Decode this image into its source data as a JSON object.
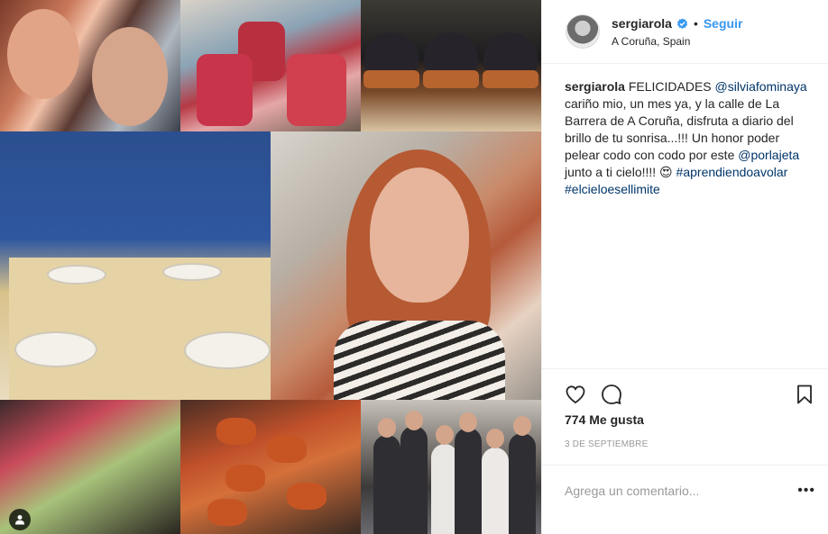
{
  "post": {
    "username": "sergiarola",
    "follow_label": "Seguir",
    "separator": "•",
    "location": "A Coruña, Spain",
    "caption": {
      "username": "sergiarola",
      "text_1": " FELICIDADES ",
      "mention_1": "@silviafominaya",
      "text_2": " cariño mio, un mes ya, y la calle de La Barrera de A Coruña, disfruta a diario del brillo de tu sonrisa...!!! Un honor poder pelear codo con codo por este ",
      "mention_2": "@porlajeta",
      "text_3": " junto a ti cielo!!!! 😍 ",
      "hashtag_1": "#aprendiendoavolar",
      "hashtag_2": "#elcieloesellimite"
    },
    "likes": "774 Me gusta",
    "date": "3 DE SEPTIEMBRE",
    "comment_placeholder": "Agrega un comentario...",
    "more_label": "•••"
  },
  "icons": {
    "verified": "verified-badge-icon",
    "like": "heart-icon",
    "comment": "comment-icon",
    "save": "bookmark-icon",
    "profile": "user-icon"
  },
  "colors": {
    "link": "#003569",
    "follow": "#3897f0",
    "verified": "#3897f0",
    "meta": "#999999"
  }
}
